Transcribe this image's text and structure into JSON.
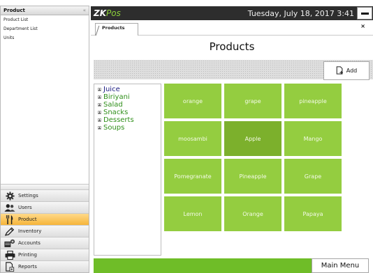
{
  "sidebar": {
    "header_title": "Product",
    "collapse_glyph": "«",
    "items": [
      {
        "label": "Product List"
      },
      {
        "label": "Department List"
      },
      {
        "label": "Units"
      }
    ],
    "menu": [
      {
        "label": "Settings",
        "icon": "gear-icon"
      },
      {
        "label": "Users",
        "icon": "users-icon"
      },
      {
        "label": "Product",
        "icon": "fork-knife-icon",
        "active": true
      },
      {
        "label": "Inventory",
        "icon": "pencil-icon"
      },
      {
        "label": "Accounts",
        "icon": "accounts-icon"
      },
      {
        "label": "Printing",
        "icon": "printer-icon"
      },
      {
        "label": "Reports",
        "icon": "report-icon"
      }
    ]
  },
  "topbar": {
    "logo_zk": "ZK",
    "logo_pos": "Pos",
    "datetime": "Tuesday, July 18, 2017 3:41"
  },
  "tabs": [
    {
      "label": "Products"
    }
  ],
  "close_glyph": "×",
  "main": {
    "title": "Products",
    "add_label": "Add"
  },
  "categories": [
    "Juice",
    "Biriyani",
    "Salad",
    "Snacks",
    "Desserts",
    "Soups"
  ],
  "products": [
    [
      "orange",
      "grape",
      "pineapple"
    ],
    [
      "moosambi",
      "Apple",
      "Mango"
    ],
    [
      "Pomegranate",
      "Pineapple",
      "Grape"
    ],
    [
      "Lemon",
      "Orange",
      "Papaya"
    ]
  ],
  "footer": {
    "main_menu_label": "Main Menu"
  },
  "colors": {
    "tile": "#94cd40",
    "tile_selected": "#7cb02c",
    "bottom_bar": "#6fbd28",
    "active_menu": "#f6b53a",
    "topbar": "#2d2d2d"
  }
}
